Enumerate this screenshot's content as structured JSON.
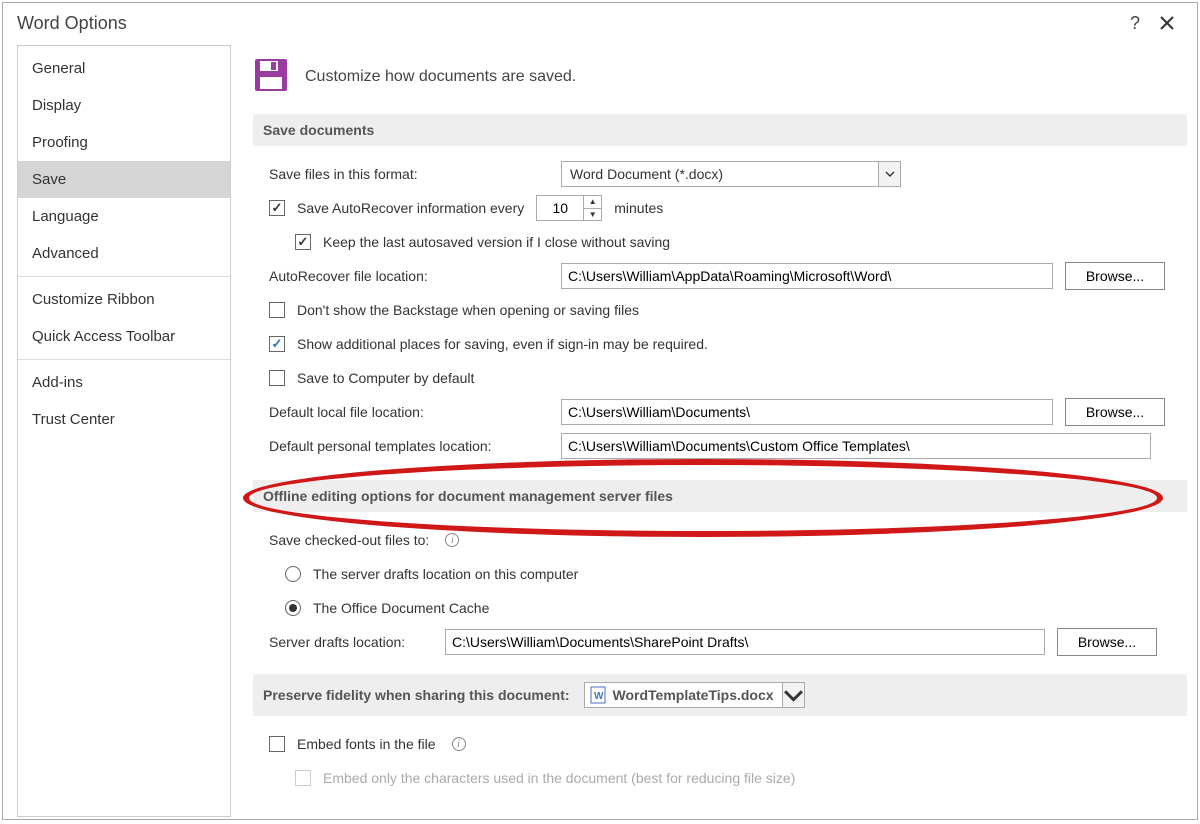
{
  "window": {
    "title": "Word Options",
    "help_tooltip": "?"
  },
  "sidebar": {
    "items": [
      {
        "label": "General"
      },
      {
        "label": "Display"
      },
      {
        "label": "Proofing"
      },
      {
        "label": "Save",
        "selected": true
      },
      {
        "label": "Language"
      },
      {
        "label": "Advanced"
      },
      {
        "label": "Customize Ribbon"
      },
      {
        "label": "Quick Access Toolbar"
      },
      {
        "label": "Add-ins"
      },
      {
        "label": "Trust Center"
      }
    ]
  },
  "header": {
    "text": "Customize how documents are saved."
  },
  "buttons": {
    "browse": "Browse..."
  },
  "save_documents": {
    "heading": "Save documents",
    "format_label": "Save files in this format:",
    "format_value": "Word Document (*.docx)",
    "autorecover_label": "Save AutoRecover information every",
    "autorecover_checked": true,
    "autorecover_minutes": "10",
    "minutes_label": "minutes",
    "keep_last_label": "Keep the last autosaved version if I close without saving",
    "keep_last_checked": true,
    "autorecover_loc_label": "AutoRecover file location:",
    "autorecover_loc_value": "C:\\Users\\William\\AppData\\Roaming\\Microsoft\\Word\\",
    "dont_show_backstage_label": "Don't show the Backstage when opening or saving files",
    "dont_show_backstage_checked": false,
    "show_additional_label": "Show additional places for saving, even if sign-in may be required.",
    "show_additional_checked": true,
    "save_to_computer_label": "Save to Computer by default",
    "save_to_computer_checked": false,
    "default_local_label": "Default local file location:",
    "default_local_value": "C:\\Users\\William\\Documents\\",
    "personal_templates_label": "Default personal templates location:",
    "personal_templates_value": "C:\\Users\\William\\Documents\\Custom Office Templates\\"
  },
  "offline": {
    "heading": "Offline editing options for document management server files",
    "save_checked_out_label": "Save checked-out files to:",
    "radio_server_drafts": "The server drafts location on this computer",
    "radio_office_cache": "The Office Document Cache",
    "selected": "cache",
    "server_drafts_label": "Server drafts location:",
    "server_drafts_value": "C:\\Users\\William\\Documents\\SharePoint Drafts\\"
  },
  "preserve": {
    "heading": "Preserve fidelity when sharing this document:",
    "doc_name": "WordTemplateTips.docx",
    "embed_fonts_label": "Embed fonts in the file",
    "embed_fonts_checked": false,
    "embed_only_chars_label": "Embed only the characters used in the document (best for reducing file size)"
  }
}
